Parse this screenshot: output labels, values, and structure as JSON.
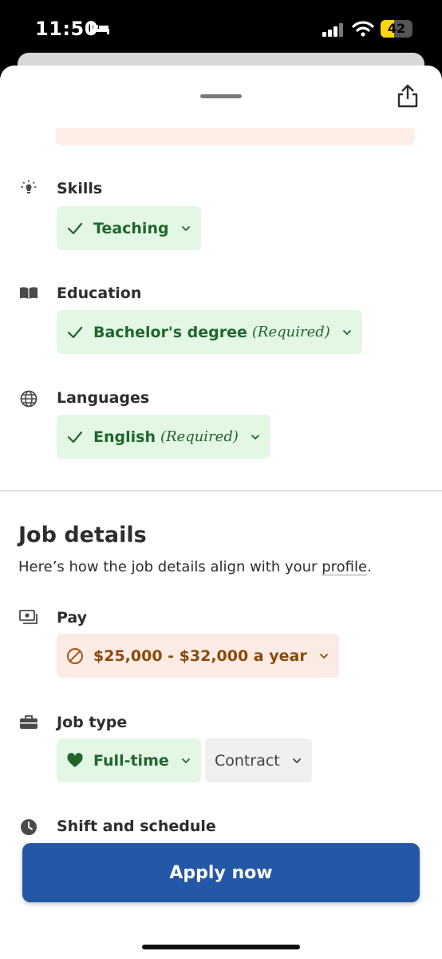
{
  "status_bar": {
    "time": "11:50",
    "battery": "42",
    "battery_level": 0.42
  },
  "sections": {
    "skills": {
      "label": "Skills",
      "chip": {
        "text": "Teaching"
      }
    },
    "education": {
      "label": "Education",
      "chip": {
        "text": "Bachelor's degree",
        "qualifier": "(Required)"
      }
    },
    "languages": {
      "label": "Languages",
      "chip": {
        "text": "English",
        "qualifier": "(Required)"
      }
    }
  },
  "job_details": {
    "title": "Job details",
    "subtitle_prefix": "Here’s how the job details align with your ",
    "subtitle_link": "profile",
    "subtitle_suffix": ".",
    "pay": {
      "label": "Pay",
      "chip": {
        "text": "$25,000 - $32,000 a year"
      }
    },
    "job_type": {
      "label": "Job type",
      "chips": [
        {
          "text": "Full-time"
        },
        {
          "text": "Contract"
        }
      ]
    },
    "shift": {
      "label": "Shift and schedule"
    }
  },
  "apply_button": "Apply now",
  "colors": {
    "match_green_bg": "#e4f7e4",
    "match_green_text": "#1f662c",
    "mismatch_bg": "#fcebe4",
    "mismatch_text": "#8a4a0d",
    "neutral_bg": "#f2f0ef",
    "primary_blue": "#2557a7"
  },
  "icons": {
    "share": "share-icon",
    "skills": "lightbulb-icon",
    "education": "book-icon",
    "languages": "globe-icon",
    "pay": "cash-icon",
    "job_type": "briefcase-icon",
    "shift": "clock-icon",
    "match": "checkmark-icon",
    "mismatch": "prohibited-icon",
    "preferred": "heart-icon",
    "expand": "chevron-down-icon"
  }
}
